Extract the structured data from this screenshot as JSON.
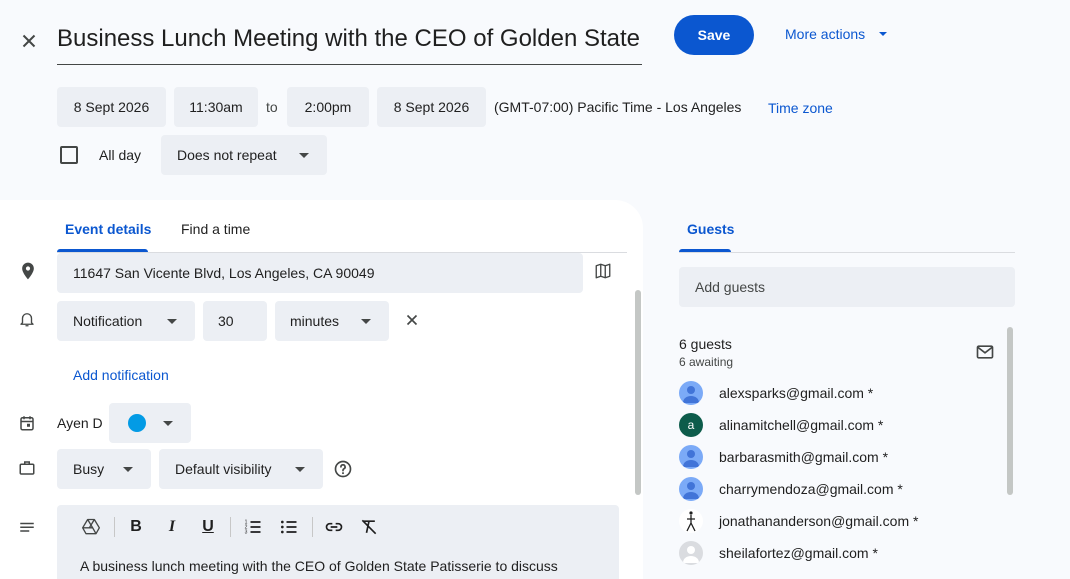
{
  "event": {
    "title": "Business Lunch Meeting with the CEO of Golden State",
    "save_label": "Save",
    "more_actions_label": "More actions"
  },
  "datetime": {
    "start_date": "8 Sept 2026",
    "start_time": "11:30am",
    "to_label": "to",
    "end_time": "2:00pm",
    "end_date": "8 Sept 2026",
    "timezone": "(GMT-07:00) Pacific Time - Los Angeles",
    "timezone_link": "Time zone",
    "all_day_label": "All day",
    "all_day_checked": false,
    "repeat": "Does not repeat"
  },
  "tabs": {
    "event_details": "Event details",
    "find_a_time": "Find a time",
    "active": "event_details"
  },
  "details": {
    "location": "11647 San Vicente Blvd, Los Angeles, CA 90049",
    "notification_type": "Notification",
    "notification_value": "30",
    "notification_unit": "minutes",
    "add_notification": "Add notification",
    "calendar_owner": "Ayen D",
    "calendar_color": "#039be5",
    "availability": "Busy",
    "visibility": "Default visibility",
    "description": "A business lunch meeting with the CEO of Golden State Patisserie to discuss"
  },
  "guests_panel": {
    "tab_label": "Guests",
    "add_placeholder": "Add guests",
    "count": "6 guests",
    "awaiting": "6 awaiting",
    "list": [
      {
        "email": "alexsparks@gmail.com *",
        "avatar": "person",
        "avatar_color": "#7baaf7",
        "initial": ""
      },
      {
        "email": "alinamitchell@gmail.com *",
        "avatar": "initial",
        "avatar_color": "#0d5c4b",
        "initial": "a"
      },
      {
        "email": "barbarasmith@gmail.com *",
        "avatar": "person",
        "avatar_color": "#7baaf7",
        "initial": ""
      },
      {
        "email": "charrymendoza@gmail.com *",
        "avatar": "person",
        "avatar_color": "#7baaf7",
        "initial": ""
      },
      {
        "email": "jonathananderson@gmail.com *",
        "avatar": "figure",
        "avatar_color": "#ffffff",
        "initial": ""
      },
      {
        "email": "sheilafortez@gmail.com *",
        "avatar": "person",
        "avatar_color": "#dadce0",
        "initial": ""
      }
    ]
  },
  "colors": {
    "accent": "#0b57d0",
    "chip_bg": "#eceff4",
    "page_bg": "#f8fafd"
  }
}
